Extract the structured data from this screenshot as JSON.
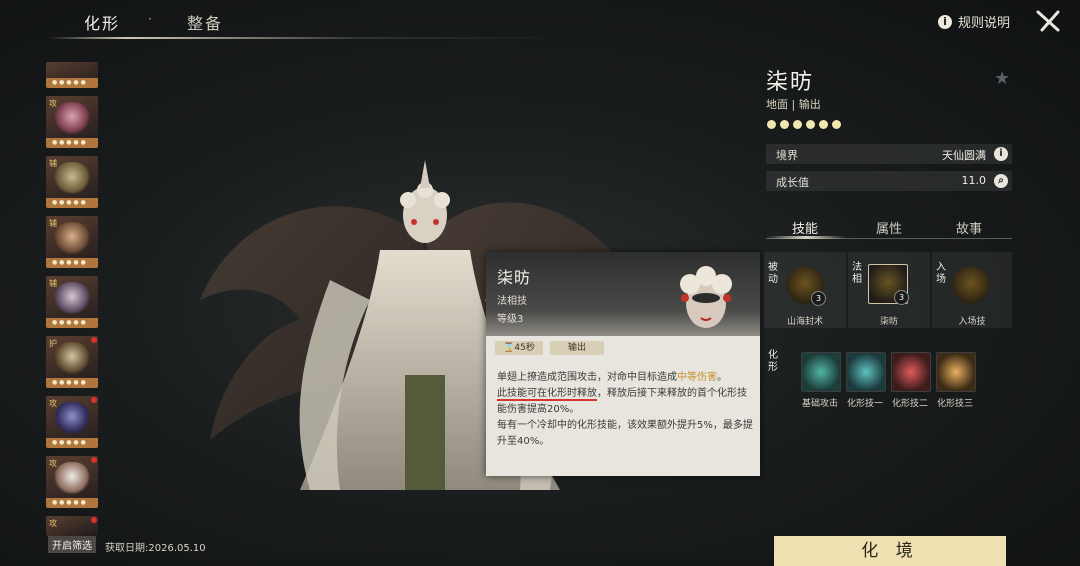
{
  "top_tabs": [
    {
      "label": "化形"
    },
    {
      "label": "整备"
    }
  ],
  "rules_label": "规则说明",
  "roster": {
    "tags": [
      "",
      "攻",
      "辅",
      "辅",
      "辅",
      "护",
      "攻",
      "攻",
      "攻"
    ]
  },
  "filter_label": "开启筛选",
  "footer_text": "获取日期:2026.05.10",
  "character": {
    "name": "柒昉",
    "type": "地面 | 输出",
    "stars": 6,
    "realm_label": "境界",
    "realm_value": "天仙圆满",
    "growth_label": "成长值",
    "growth_value": "11.0"
  },
  "right_tabs": [
    {
      "label": "技能"
    },
    {
      "label": "属性"
    },
    {
      "label": "故事"
    }
  ],
  "skills": {
    "passive_cat": "被动",
    "passive_name": "山海封术",
    "passive_level": "3",
    "dharma_cat": "法相",
    "dharma_name": "柒昉",
    "dharma_level": "3",
    "entry_cat": "入场",
    "entry_name": "入场技",
    "form_cat": "化形",
    "form_skills": [
      "基础攻击",
      "化形技一",
      "化形技二",
      "化形技三"
    ]
  },
  "bottom_button": "化 境",
  "tooltip": {
    "name": "柒昉",
    "category": "法相技",
    "level": "等级3",
    "cooldown": "45秒",
    "role": "输出",
    "p1_a": "单翅上撩造成范围攻击，对命中目标造成",
    "p1_hl": "中等伤害",
    "p1_b": "。",
    "p2_ul": "此技能可在化形时释放",
    "p2_b": "，释放后接下来释放的首个化形技能伤害提高20%。",
    "p3": "每有一个冷却中的化形技能，该效果额外提升5%，最多提升至40%。"
  },
  "colors": {
    "accent_gold": "#efe0b1",
    "highlight": "#c98f2a",
    "underline_red": "#d2382c",
    "roster_bar": "#b0763d"
  }
}
